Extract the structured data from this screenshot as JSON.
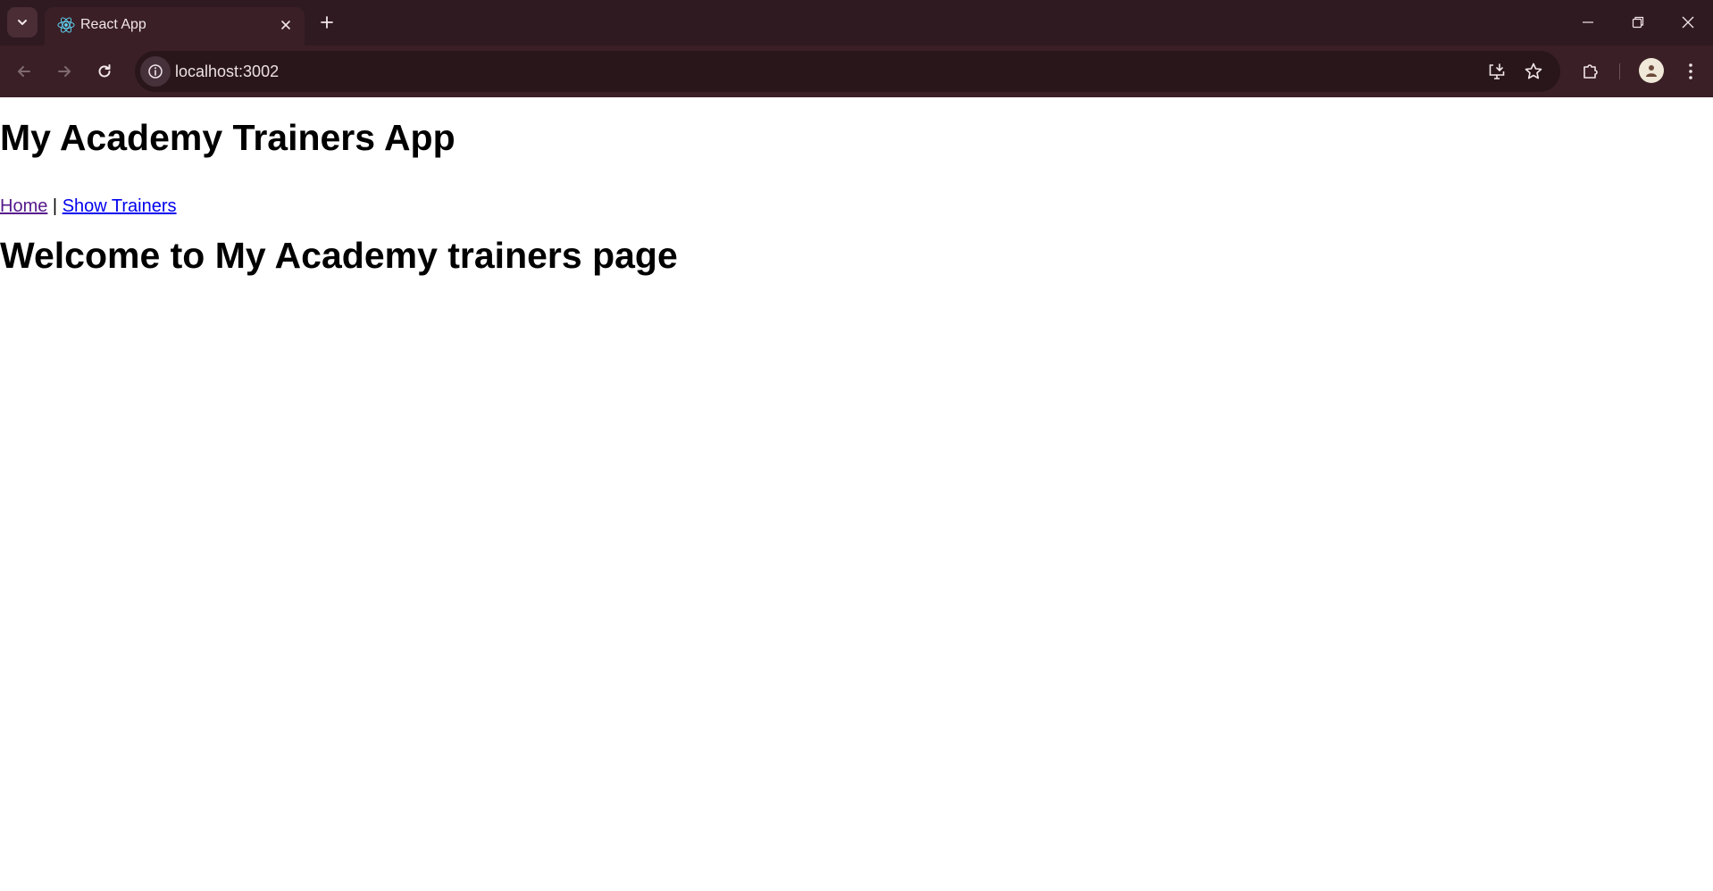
{
  "browser": {
    "tab": {
      "title": "React App",
      "favicon": "react-icon"
    },
    "address_bar": {
      "url": "localhost:3002"
    },
    "colors": {
      "tabstrip_bg": "#301a21",
      "toolbar_bg": "#3a1f26",
      "omnibox_bg": "#29161b"
    }
  },
  "page": {
    "title": "My Academy Trainers App",
    "nav": {
      "home_label": "Home",
      "separator": "|",
      "show_trainers_label": "Show Trainers"
    },
    "welcome_heading": "Welcome to My Academy trainers page"
  }
}
